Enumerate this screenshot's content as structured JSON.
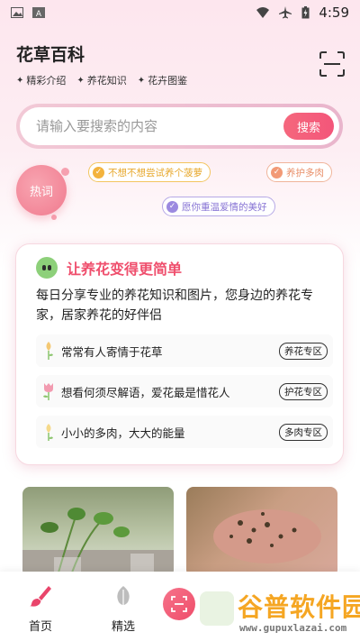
{
  "status_bar": {
    "time": "4:59"
  },
  "header": {
    "title": "花草百科",
    "subnav": [
      "精彩介绍",
      "养花知识",
      "花卉图鉴"
    ]
  },
  "search": {
    "placeholder": "请输入要搜索的内容",
    "button": "搜索"
  },
  "hot": {
    "label": "热词",
    "chips": [
      "不想不想尝试养个菠萝",
      "养护多肉",
      "愿你重温爱情的美好"
    ]
  },
  "card": {
    "title": "让养花变得更简单",
    "description": "每日分享专业的养花知识和图片，您身边的养花专家，居家养花的好伴侣",
    "rows": [
      {
        "text": "常常有人寄情于花草",
        "tag": "养花专区"
      },
      {
        "text": "想看何须尽解语，爱花最是惜花人",
        "tag": "护花专区"
      },
      {
        "text": "小小的多肉，大大的能量",
        "tag": "多肉专区"
      }
    ]
  },
  "bottom_nav": {
    "home": "首页",
    "select": "精选"
  },
  "watermark": {
    "text": "谷普软件园",
    "url": "www.gupuxlazai.com"
  },
  "colors": {
    "accent": "#ef4f6d",
    "search_button": "#f3567a"
  }
}
